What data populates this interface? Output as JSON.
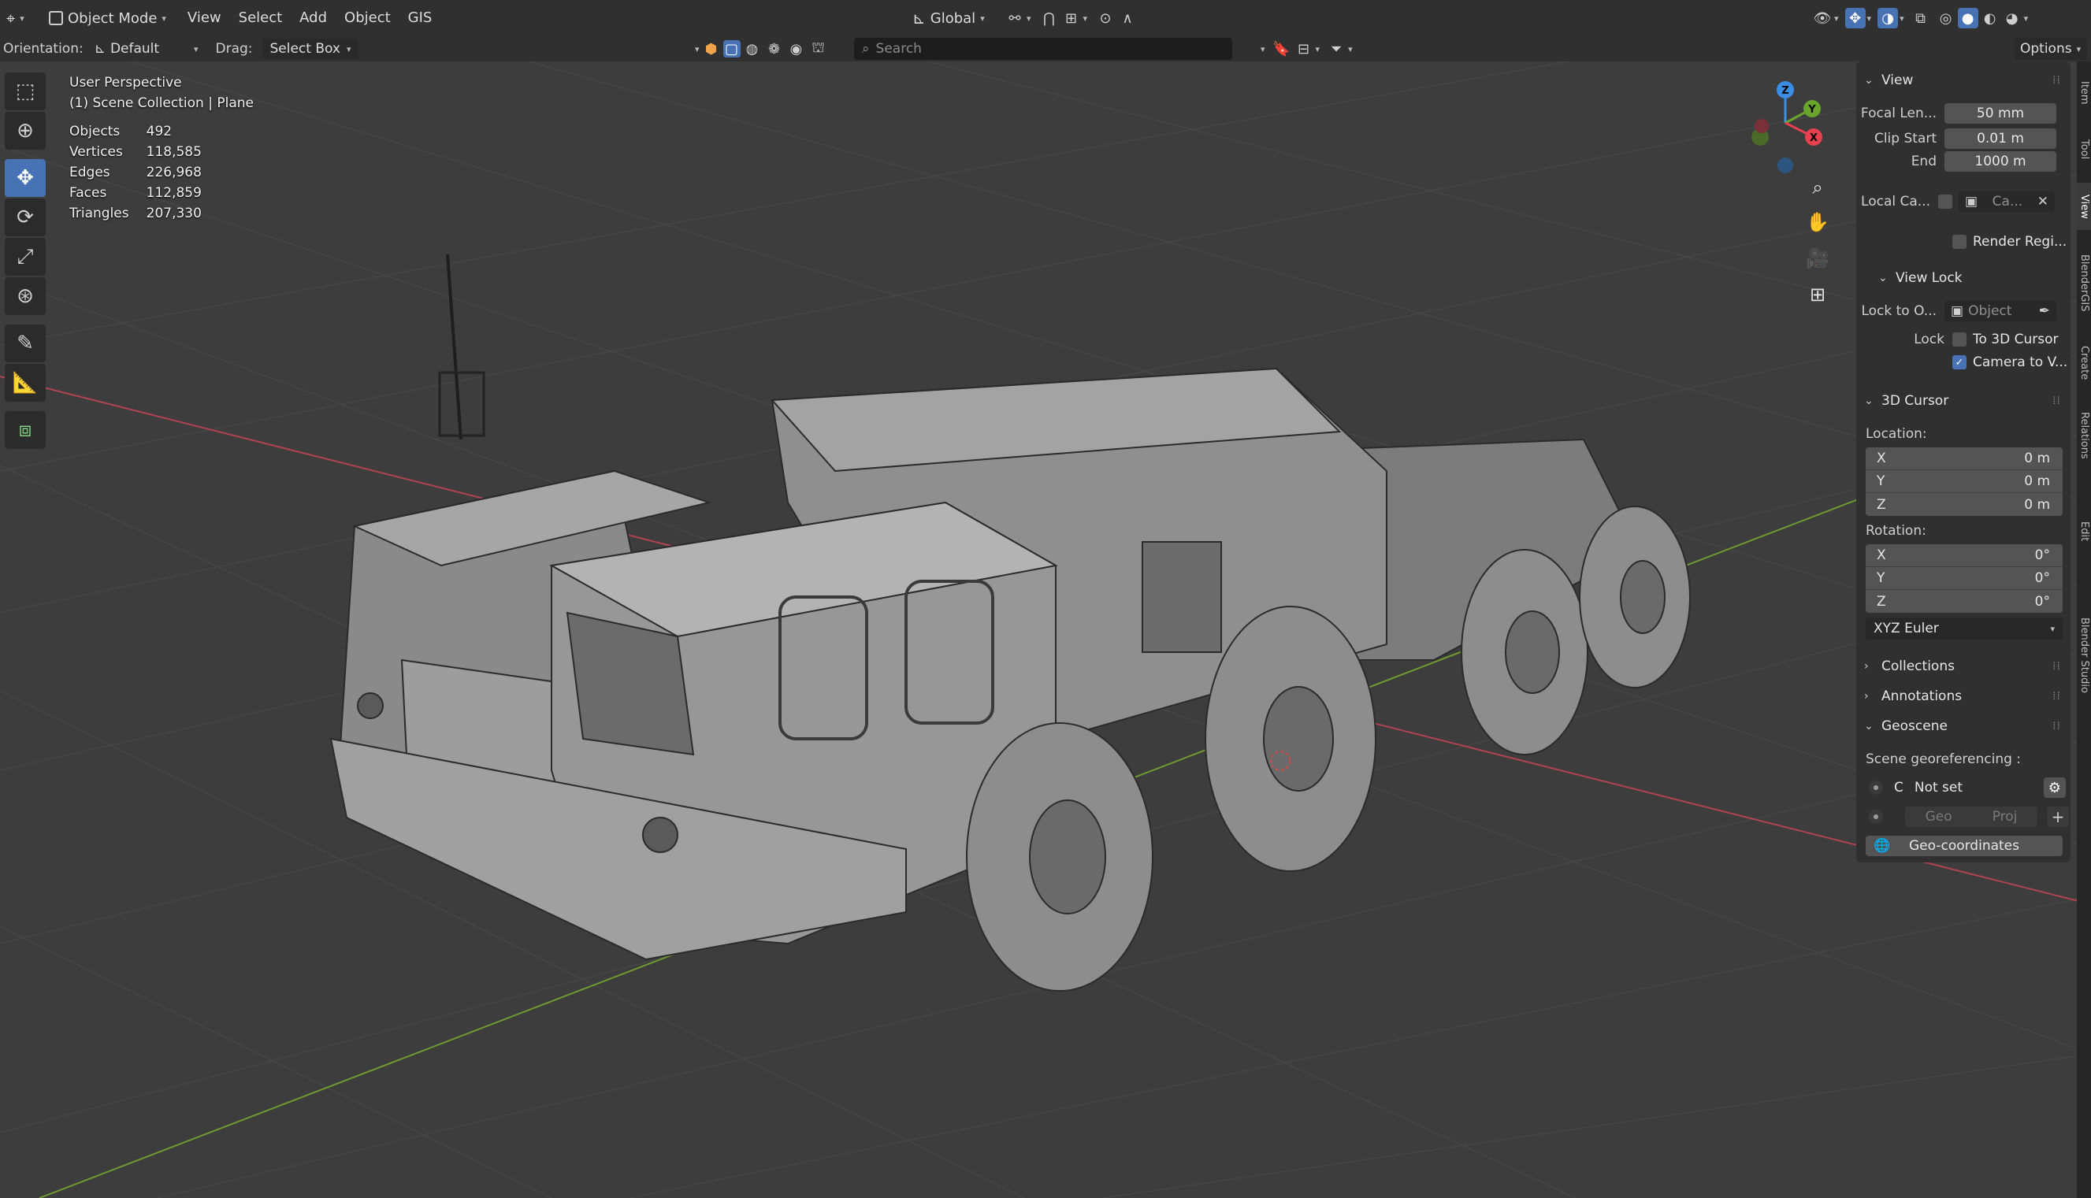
{
  "header": {
    "editor_type_icon": "view3d-icon",
    "mode": "Object Mode",
    "menus": [
      "View",
      "Select",
      "Add",
      "Object",
      "GIS"
    ],
    "transform_orientation": "Global",
    "orientation_label": "Orientation:",
    "orientation_value": "Default",
    "drag_label": "Drag:",
    "drag_value": "Select Box",
    "search_placeholder": "Search",
    "options_label": "Options"
  },
  "overlay": {
    "perspective": "User Perspective",
    "collection": "(1) Scene Collection | Plane",
    "stats": [
      {
        "label": "Objects",
        "value": "492"
      },
      {
        "label": "Vertices",
        "value": "118,585"
      },
      {
        "label": "Edges",
        "value": "226,968"
      },
      {
        "label": "Faces",
        "value": "112,859"
      },
      {
        "label": "Triangles",
        "value": "207,330"
      }
    ]
  },
  "gizmo": {
    "z": "Z",
    "y": "Y",
    "x": "X",
    "colors": {
      "x": "#e8404f",
      "y": "#6aa52c",
      "z": "#3a8ee6"
    }
  },
  "tools": [
    "select-box-icon",
    "cursor-icon",
    "move-icon",
    "rotate-icon",
    "scale-icon",
    "transform-icon",
    "annotate-icon",
    "measure-icon",
    "add-cube-icon"
  ],
  "sidebar": {
    "view": {
      "title": "View",
      "focal_label": "Focal Len...",
      "focal_value": "50 mm",
      "clip_start_label": "Clip Start",
      "clip_start_value": "0.01 m",
      "end_label": "End",
      "end_value": "1000 m",
      "local_camera_label": "Local Ca...",
      "local_camera_value": "Ca...",
      "render_region_label": "Render Regi..."
    },
    "view_lock": {
      "title": "View Lock",
      "lock_to_object_label": "Lock to O...",
      "lock_to_object_placeholder": "Object",
      "lock_label": "Lock",
      "to_3d_cursor_label": "To 3D Cursor",
      "to_3d_cursor_checked": false,
      "camera_to_view_label": "Camera to V...",
      "camera_to_view_checked": true
    },
    "cursor": {
      "title": "3D Cursor",
      "location_label": "Location:",
      "location": [
        {
          "axis": "X",
          "value": "0 m"
        },
        {
          "axis": "Y",
          "value": "0 m"
        },
        {
          "axis": "Z",
          "value": "0 m"
        }
      ],
      "rotation_label": "Rotation:",
      "rotation": [
        {
          "axis": "X",
          "value": "0°"
        },
        {
          "axis": "Y",
          "value": "0°"
        },
        {
          "axis": "Z",
          "value": "0°"
        }
      ],
      "rotation_mode": "XYZ Euler"
    },
    "collections_title": "Collections",
    "annotations_title": "Annotations",
    "geoscene": {
      "title": "Geoscene",
      "georef_label": "Scene georeferencing :",
      "crs_letter": "C",
      "crs_value": "Not set",
      "geo_label": "Geo",
      "proj_label": "Proj",
      "geocoords_label": "Geo-coordinates"
    }
  },
  "side_tabs": [
    "Item",
    "Tool",
    "View",
    "BlenderGIS",
    "Create",
    "Relations",
    "Edit",
    "Blender Studio"
  ]
}
